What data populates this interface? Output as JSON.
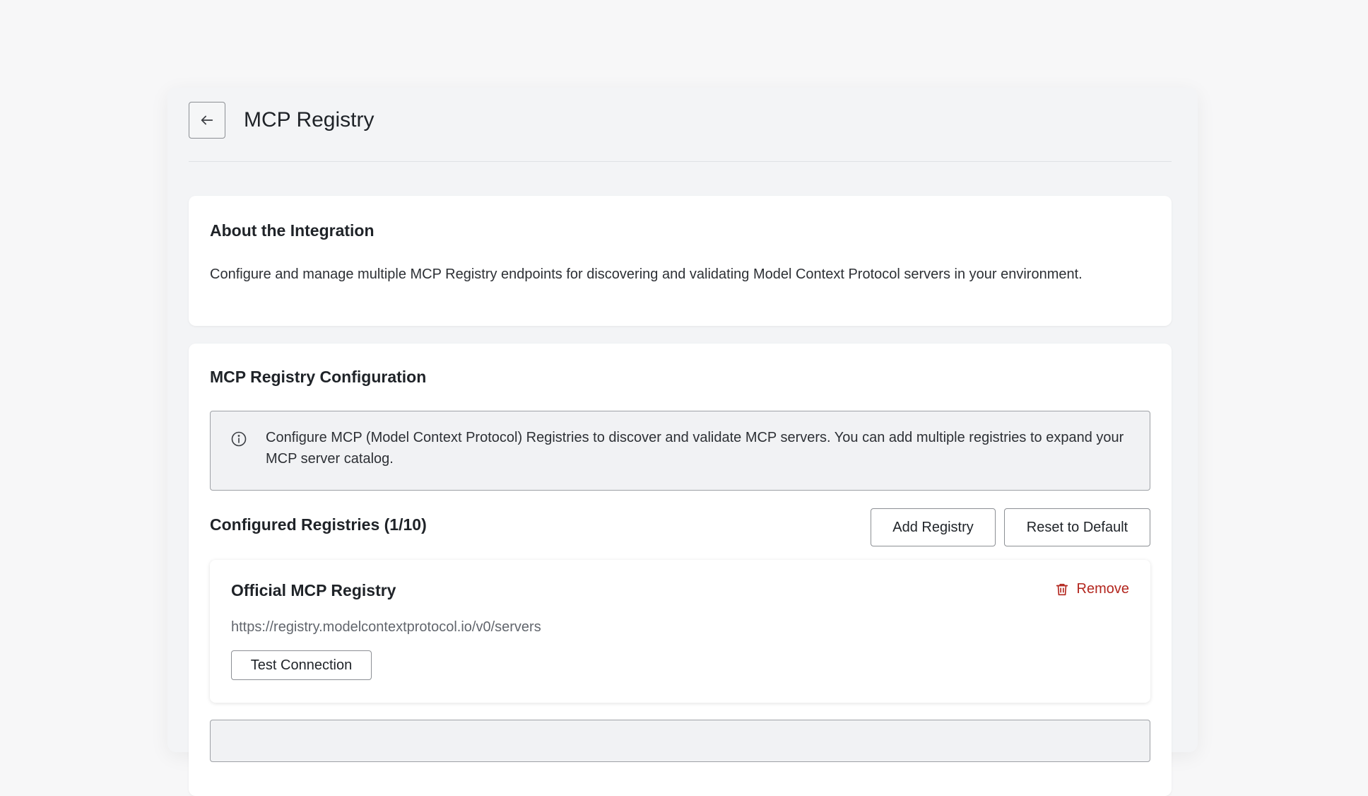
{
  "header": {
    "title": "MCP Registry",
    "back_icon": "arrow-left-icon"
  },
  "about": {
    "title": "About the Integration",
    "description": "Configure and manage multiple MCP Registry endpoints for discovering and validating Model Context Protocol servers in your environment."
  },
  "config": {
    "title": "MCP Registry Configuration",
    "info_icon": "info-icon",
    "info_text": "Configure MCP (Model Context Protocol) Registries to discover and validate MCP servers. You can add multiple registries to expand your MCP server catalog.",
    "registries_heading": "Configured Registries (1/10)",
    "add_label": "Add Registry",
    "reset_label": "Reset to Default",
    "registries": [
      {
        "name": "Official MCP Registry",
        "url": "https://registry.modelcontextprotocol.io/v0/servers",
        "remove_label": "Remove",
        "remove_icon": "trash-icon",
        "test_label": "Test Connection"
      }
    ]
  },
  "colors": {
    "danger": "#b3261e",
    "page_bg": "#f7f7f8",
    "panel_bg": "#f3f4f6",
    "card_bg": "#ffffff",
    "info_bg": "#f1f2f4"
  }
}
